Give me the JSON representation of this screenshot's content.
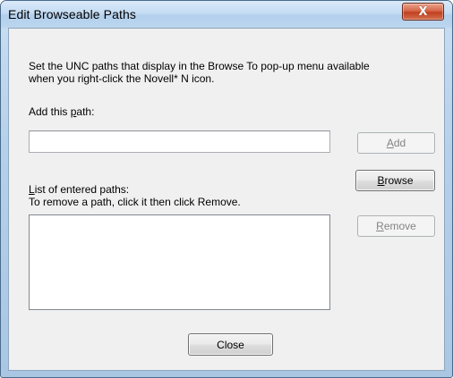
{
  "window": {
    "title": "Edit Browseable Paths",
    "close_glyph": "X"
  },
  "dialog": {
    "description_line1": "Set the UNC paths that display in the Browse To pop-up menu available",
    "description_line2": "when you right-click the Novell* N icon.",
    "add_path_label_prefix": "Add this ",
    "add_path_label_accel": "p",
    "add_path_label_suffix": "ath:",
    "add_path_value": "",
    "list_label_accel": "L",
    "list_label_rest": "ist of entered paths:",
    "list_hint": "To remove a path, click it then click Remove.",
    "paths": []
  },
  "buttons": {
    "add_accel": "A",
    "add_rest": "dd",
    "add_enabled": false,
    "browse_accel": "B",
    "browse_rest": "rowse",
    "browse_enabled": true,
    "remove_accel": "R",
    "remove_rest": "emove",
    "remove_enabled": false,
    "close_label": "Close"
  },
  "colors": {
    "title_bar": "#c4dcf2",
    "close_button": "#c2401f",
    "dialog_face": "#f0f0f0"
  }
}
